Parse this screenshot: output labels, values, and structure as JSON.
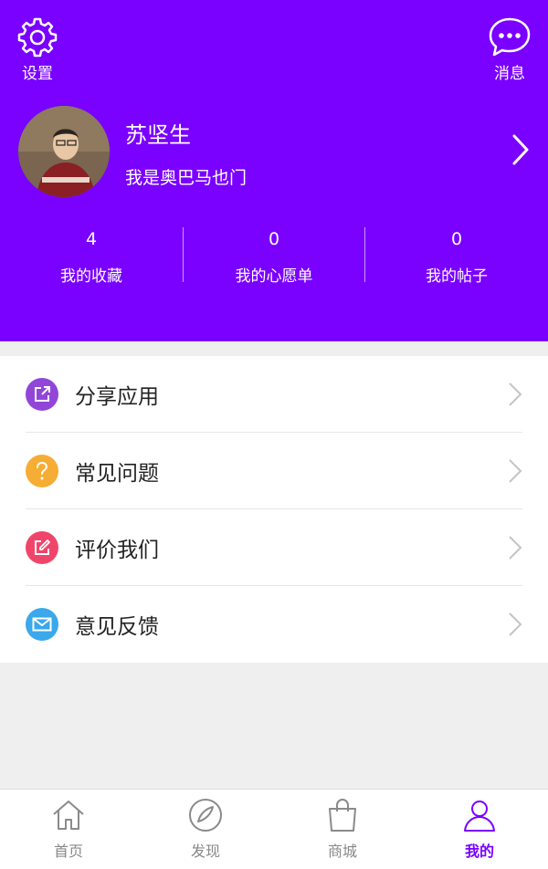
{
  "header": {
    "settings_label": "设置",
    "message_label": "消息",
    "user_name": "苏坚生",
    "signature": "我是奥巴马也门",
    "stats": [
      {
        "count": "4",
        "label": "我的收藏"
      },
      {
        "count": "0",
        "label": "我的心愿单"
      },
      {
        "count": "0",
        "label": "我的帖子"
      }
    ]
  },
  "menu": [
    {
      "label": "分享应用",
      "icon": "share-icon",
      "color": "#9146d8"
    },
    {
      "label": "常见问题",
      "icon": "question-icon",
      "color": "#f5ad34"
    },
    {
      "label": "评价我们",
      "icon": "edit-icon",
      "color": "#f0456b"
    },
    {
      "label": "意见反馈",
      "icon": "mail-icon",
      "color": "#3aa8ea"
    }
  ],
  "tabbar": [
    {
      "label": "首页",
      "icon": "home-icon"
    },
    {
      "label": "发现",
      "icon": "compass-icon"
    },
    {
      "label": "商城",
      "icon": "shopping-bag-icon"
    },
    {
      "label": "我的",
      "icon": "user-icon",
      "active": true
    }
  ],
  "colors": {
    "accent": "#7a00ff",
    "background": "#efefef"
  }
}
